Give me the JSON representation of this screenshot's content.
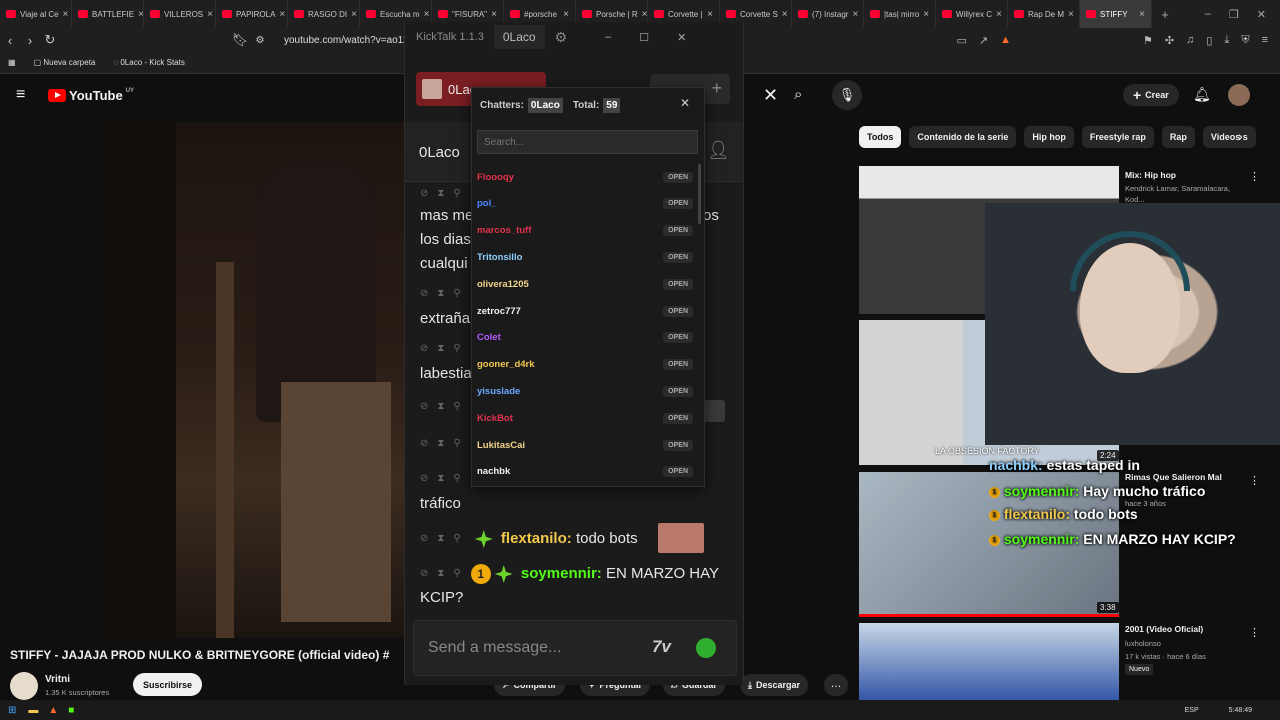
{
  "browser": {
    "tabs": [
      {
        "label": "Viaje al Ce"
      },
      {
        "label": "BATTLEFIE"
      },
      {
        "label": "VILLEROS"
      },
      {
        "label": "PAPIROLA"
      },
      {
        "label": "RASGO DI"
      },
      {
        "label": "Escucha m"
      },
      {
        "label": "\"FISURA\""
      },
      {
        "label": "#porsche"
      },
      {
        "label": "Porsche | R"
      },
      {
        "label": "Corvette |"
      },
      {
        "label": "Corvette S"
      },
      {
        "label": "(7) Instagr"
      },
      {
        "label": "|tas| mirro"
      },
      {
        "label": "Willyrex C"
      },
      {
        "label": "Rap De M"
      },
      {
        "label": "STIFFY"
      }
    ],
    "url": "youtube.com/watch?v=ao11a",
    "bookmarks": [
      "Nueva carpeta",
      "0Laco - Kick Stats"
    ]
  },
  "youtube": {
    "logo_text": "YouTube",
    "region": "UY",
    "create_label": "Crear",
    "chips": [
      "Todos",
      "Contenido de la serie",
      "Hip hop",
      "Freestyle rap",
      "Rap",
      "Videos s"
    ],
    "video_title": "STIFFY - JAJAJA PROD NULKO & BRITNEYGORE (official video) #",
    "channel_name": "Vritni",
    "subscribers": "1.35 K suscriptores",
    "subscribe_label": "Suscribirse",
    "actions": [
      "Compartir",
      "Preguntar",
      "Guardar",
      "Descargar"
    ],
    "recs": [
      {
        "title": "Mix: Hip hop",
        "meta": "Kendrick Lamar, Saramalacara, Kod..."
      },
      {
        "title": "Rimas Que Salieron Mal",
        "meta": "hace 3 años",
        "duration": "2:24"
      },
      {
        "title": "",
        "meta": "",
        "duration": "3:38"
      },
      {
        "title": "2001 (Video Oficial)",
        "meta1": "luxholonso",
        "meta2": "17 k vistas · hace 6 días",
        "tag": "Nuevo"
      }
    ]
  },
  "kicktalk": {
    "title": "KickTalk 1.1.3",
    "tab_user": "0Laco",
    "channel_name": "0Laco",
    "chat_lines": [
      {
        "text": "mas me"
      },
      {
        "text": "los dias"
      },
      {
        "text": "cualqui"
      },
      {
        "text": "extraña"
      },
      {
        "text": "labestia"
      },
      {
        "text": "tráfico"
      },
      {
        "user": "flextanilo:",
        "text": "todo bots"
      },
      {
        "user": "soymennir:",
        "text": "EN MARZO HAY KCIP?"
      }
    ],
    "partial_right": "os",
    "send_placeholder": "Send a message...",
    "modal": {
      "chatters_label": "Chatters:",
      "chatters_user": "0Laco",
      "total_label": "Total:",
      "total_value": "59",
      "search_placeholder": "Search...",
      "open_label": "OPEN",
      "users": [
        {
          "name": "Floooqy",
          "color": "#e0334c"
        },
        {
          "name": "pol_",
          "color": "#4a88ff"
        },
        {
          "name": "marcos_tuff",
          "color": "#e0334c"
        },
        {
          "name": "Tritonsillo",
          "color": "#8ed0ff"
        },
        {
          "name": "olivera1205",
          "color": "#f2d48a"
        },
        {
          "name": "zetroc777",
          "color": "#f1f1f1"
        },
        {
          "name": "Colet",
          "color": "#b45cff"
        },
        {
          "name": "gooner_d4rk",
          "color": "#f2c94c"
        },
        {
          "name": "yisuslade",
          "color": "#6aa8ff"
        },
        {
          "name": "KickBot",
          "color": "#e0334c"
        },
        {
          "name": "LukitasCai",
          "color": "#f2d48a"
        },
        {
          "name": "nachbk",
          "color": "#f1f1f1"
        }
      ]
    }
  },
  "overlay": [
    {
      "user": "nachbk:",
      "text": "estas taped in"
    },
    {
      "user": "soymennir:",
      "text": "Hay mucho tráfico"
    },
    {
      "user": "flextanilo:",
      "text": "todo bots"
    },
    {
      "user": "soymennir:",
      "text": "EN MARZO HAY KCIP?"
    }
  ],
  "overlay_brand": "LA OBSESION FACTORY",
  "taskbar": {
    "lang": "ESP",
    "time": "5:48:49"
  },
  "colors": {
    "kick_green": "#53fc18",
    "yt_red": "#ff0000",
    "chip_bg": "#272727"
  }
}
